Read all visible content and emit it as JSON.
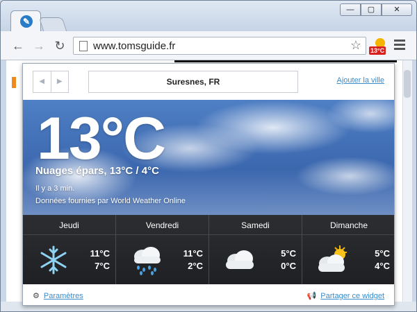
{
  "browser": {
    "url": "www.tomsguide.fr",
    "window_buttons": [
      "—",
      "▢",
      "✕"
    ],
    "extension_badge": "13°C"
  },
  "popup": {
    "city": "Suresnes, FR",
    "add_city": "Ajouter la ville",
    "current": {
      "temperature": "13°C",
      "condition": "Nuages épars, 13°C / 4°C",
      "updated": "Il y a 3 min.",
      "source": "Données fournies par World Weather Online"
    },
    "forecast": [
      {
        "day": "Jeudi",
        "high": "11°C",
        "low": "7°C",
        "icon": "snowflake-icon"
      },
      {
        "day": "Vendredi",
        "high": "11°C",
        "low": "2°C",
        "icon": "rain-cloud-icon"
      },
      {
        "day": "Samedi",
        "high": "5°C",
        "low": "0°C",
        "icon": "cloud-icon"
      },
      {
        "day": "Dimanche",
        "high": "5°C",
        "low": "4°C",
        "icon": "sun-cloud-icon"
      }
    ],
    "footer": {
      "settings": "Paramètres",
      "share": "Partager ce widget"
    }
  }
}
